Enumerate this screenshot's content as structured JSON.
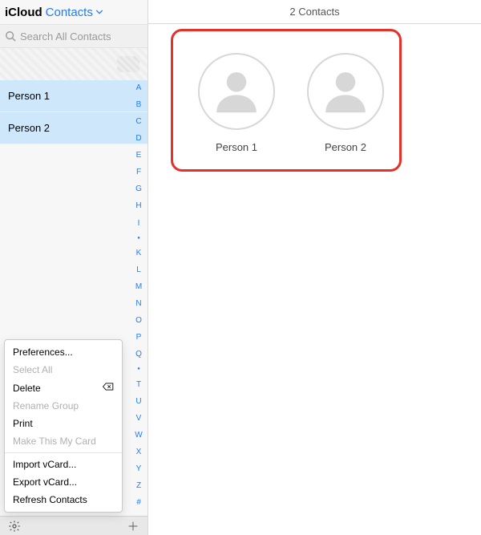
{
  "header": {
    "app_name": "iCloud",
    "section_label": "Contacts"
  },
  "search": {
    "placeholder": "Search All Contacts"
  },
  "list": {
    "items": [
      {
        "name": "Person 1"
      },
      {
        "name": "Person 2"
      }
    ]
  },
  "alpha_index": [
    "A",
    "B",
    "C",
    "D",
    "E",
    "F",
    "G",
    "H",
    "I",
    "●",
    "K",
    "L",
    "M",
    "N",
    "O",
    "P",
    "Q",
    "●",
    "T",
    "U",
    "V",
    "W",
    "X",
    "Y",
    "Z",
    "#"
  ],
  "settings_menu": {
    "items": [
      {
        "label": "Preferences...",
        "disabled": false
      },
      {
        "label": "Select All",
        "disabled": true
      },
      {
        "label": "Delete",
        "disabled": false,
        "icon": "delete"
      },
      {
        "label": "Rename Group",
        "disabled": true
      },
      {
        "label": "Print",
        "disabled": false
      },
      {
        "label": "Make This My Card",
        "disabled": true
      },
      {
        "sep": true
      },
      {
        "label": "Import vCard...",
        "disabled": false
      },
      {
        "label": "Export vCard...",
        "disabled": false
      },
      {
        "label": "Refresh Contacts",
        "disabled": false
      }
    ]
  },
  "detail": {
    "count_text": "2 Contacts",
    "cards": [
      {
        "name": "Person 1"
      },
      {
        "name": "Person 2"
      }
    ]
  },
  "colors": {
    "accent": "#1f7cff",
    "highlight": "#e4312a"
  }
}
